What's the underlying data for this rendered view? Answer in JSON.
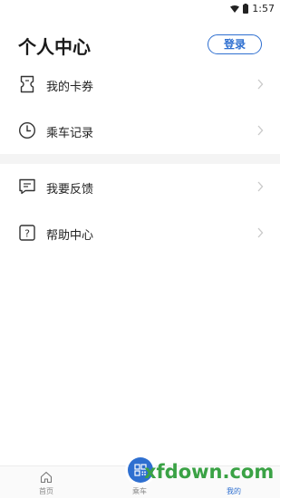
{
  "status_bar": {
    "time": "1:57"
  },
  "header": {
    "title": "个人中心",
    "login_label": "登录"
  },
  "menu": {
    "group1": [
      {
        "label": "我的卡券"
      },
      {
        "label": "乘车记录"
      }
    ],
    "group2": [
      {
        "label": "我要反馈"
      },
      {
        "label": "帮助中心"
      }
    ]
  },
  "tabbar": {
    "home_label": "首页",
    "ride_label": "乘车",
    "mine_label": "我的"
  },
  "watermark": "xfdown.com",
  "colors": {
    "accent": "#2e6fd0",
    "watermark": "#3aa245"
  }
}
